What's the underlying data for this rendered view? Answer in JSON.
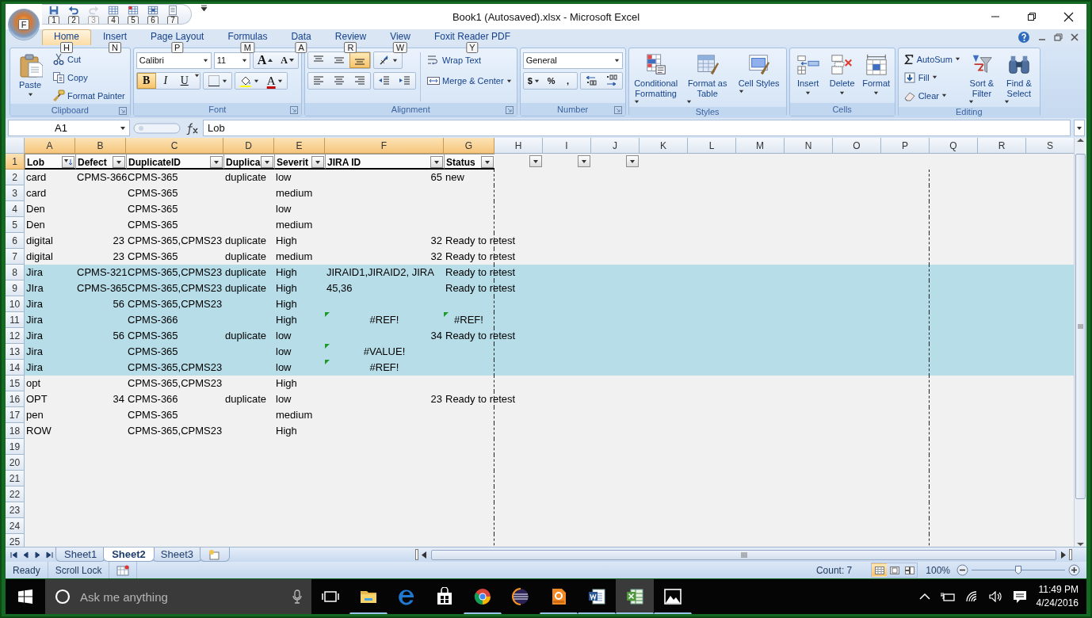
{
  "window": {
    "title": "Book1 (Autosaved).xlsx - Microsoft Excel",
    "office_keytip": "F"
  },
  "quick_access": [
    {
      "kind": "save",
      "keytip": "1",
      "disabled": false
    },
    {
      "kind": "undo",
      "keytip": "2",
      "disabled": false
    },
    {
      "kind": "redo",
      "keytip": "3",
      "disabled": true
    },
    {
      "kind": "form",
      "keytip": "4",
      "disabled": false
    },
    {
      "kind": "chart",
      "keytip": "5",
      "disabled": false
    },
    {
      "kind": "table",
      "keytip": "6",
      "disabled": false
    },
    {
      "kind": "print",
      "keytip": "7",
      "disabled": false
    }
  ],
  "tabs": [
    {
      "label": "Home",
      "keytip": "H",
      "selected": true
    },
    {
      "label": "Insert",
      "keytip": "N",
      "selected": false
    },
    {
      "label": "Page Layout",
      "keytip": "P",
      "selected": false
    },
    {
      "label": "Formulas",
      "keytip": "M",
      "selected": false
    },
    {
      "label": "Data",
      "keytip": "A",
      "selected": false
    },
    {
      "label": "Review",
      "keytip": "R",
      "selected": false
    },
    {
      "label": "View",
      "keytip": "W",
      "selected": false
    },
    {
      "label": "Foxit Reader PDF",
      "keytip": "Y",
      "selected": false
    }
  ],
  "ribbon": {
    "clipboard": {
      "label": "Clipboard",
      "paste": "Paste",
      "cut": "Cut",
      "copy": "Copy",
      "format_painter": "Format Painter"
    },
    "font": {
      "label": "Font",
      "font_name": "Calibri",
      "font_size": "11",
      "grow": "A",
      "shrink": "A",
      "bold": {
        "label": "B",
        "on": true
      },
      "italic": {
        "label": "I",
        "on": false
      },
      "underline": {
        "label": "U",
        "on": false
      },
      "font_color": "A"
    },
    "alignment": {
      "label": "Alignment",
      "vertical": [
        {
          "kind": "top",
          "on": false
        },
        {
          "kind": "middle",
          "on": false
        },
        {
          "kind": "bottom",
          "on": true
        }
      ],
      "horizontal": [
        {
          "kind": "left",
          "on": false
        },
        {
          "kind": "center",
          "on": false
        },
        {
          "kind": "right",
          "on": false
        }
      ],
      "wrap_text": "Wrap Text",
      "merge": "Merge & Center"
    },
    "number": {
      "label": "Number",
      "format": "General",
      "currency": "$",
      "percent": "%",
      "comma": ","
    },
    "styles": {
      "label": "Styles",
      "buttons": [
        {
          "kind": "conditional",
          "label": "Conditional Formatting"
        },
        {
          "kind": "table",
          "label": "Format as Table"
        },
        {
          "kind": "cellstyles",
          "label": "Cell Styles"
        }
      ]
    },
    "cells": {
      "label": "Cells",
      "buttons": [
        {
          "kind": "insert",
          "label": "Insert"
        },
        {
          "kind": "delete",
          "label": "Delete"
        },
        {
          "kind": "format",
          "label": "Format"
        }
      ]
    },
    "editing": {
      "label": "Editing",
      "autosum": "AutoSum",
      "fill": "Fill",
      "clear": "Clear",
      "sort": "Sort & Filter",
      "find": "Find & Select"
    }
  },
  "formula_bar": {
    "name_box": "A1",
    "value": "Lob"
  },
  "sheet": {
    "columns": [
      {
        "label": "A",
        "selected": true
      },
      {
        "label": "B",
        "selected": true
      },
      {
        "label": "C",
        "selected": true
      },
      {
        "label": "D",
        "selected": true
      },
      {
        "label": "E",
        "selected": true
      },
      {
        "label": "F",
        "selected": true
      },
      {
        "label": "G",
        "selected": true
      },
      {
        "label": "H",
        "selected": false
      },
      {
        "label": "I",
        "selected": false
      },
      {
        "label": "J",
        "selected": false
      },
      {
        "label": "K",
        "selected": false
      },
      {
        "label": "L",
        "selected": false
      },
      {
        "label": "M",
        "selected": false
      },
      {
        "label": "N",
        "selected": false
      },
      {
        "label": "O",
        "selected": false
      },
      {
        "label": "P",
        "selected": false
      },
      {
        "label": "Q",
        "selected": false
      },
      {
        "label": "R",
        "selected": false
      },
      {
        "label": "S",
        "selected": false
      }
    ],
    "rows": [
      {
        "number": "1",
        "selected": true,
        "shaded": false,
        "kind": "header",
        "cells": [
          {
            "text": "Lob",
            "filter": true,
            "sorted": true
          },
          {
            "text": "Defect",
            "filter": true,
            "sorted": false
          },
          {
            "text": "DuplicateID",
            "filter": true,
            "sorted": false
          },
          {
            "text": "Duplica",
            "filter": true,
            "sorted": false
          },
          {
            "text": "Severit",
            "filter": true,
            "sorted": false
          },
          {
            "text": "JIRA ID",
            "filter": true,
            "sorted": false
          },
          {
            "text": "Status",
            "filter": true,
            "sorted": false
          },
          {
            "filter": true,
            "sorted": false
          },
          {
            "filter": true,
            "sorted": false
          },
          {
            "filter": true,
            "sorted": false
          }
        ]
      },
      {
        "number": "2",
        "selected": false,
        "shaded": false,
        "kind": "data",
        "cells": [
          "card",
          "CPMS-366",
          "CPMS-365",
          "duplicate",
          "low",
          {
            "text": "65",
            "kind": "number"
          },
          "new"
        ]
      },
      {
        "number": "3",
        "selected": false,
        "shaded": false,
        "kind": "data",
        "cells": [
          "card",
          null,
          "CPMS-365",
          null,
          "medium"
        ]
      },
      {
        "number": "4",
        "selected": false,
        "shaded": false,
        "kind": "data",
        "cells": [
          "Den",
          null,
          "CPMS-365",
          null,
          "low"
        ]
      },
      {
        "number": "5",
        "selected": false,
        "shaded": false,
        "kind": "data",
        "cells": [
          "Den",
          null,
          "CPMS-365",
          null,
          "medium"
        ]
      },
      {
        "number": "6",
        "selected": false,
        "shaded": false,
        "kind": "data",
        "cells": [
          "digital",
          {
            "text": "23",
            "kind": "number"
          },
          "CPMS-365,CPMS23",
          "duplicate",
          "High",
          {
            "text": "32",
            "kind": "number"
          },
          "Ready to retest"
        ]
      },
      {
        "number": "7",
        "selected": false,
        "shaded": false,
        "kind": "data",
        "cells": [
          "digital",
          {
            "text": "23",
            "kind": "number"
          },
          "CPMS-365",
          "duplicate",
          "medium",
          {
            "text": "32",
            "kind": "number"
          },
          "Ready to retest"
        ]
      },
      {
        "number": "8",
        "selected": false,
        "shaded": true,
        "kind": "data",
        "cells": [
          "Jira",
          "CPMS-321",
          "CPMS-365,CPMS23",
          "duplicate",
          "High",
          "JIRAID1,JIRAID2, JIRA",
          "Ready to retest"
        ]
      },
      {
        "number": "9",
        "selected": false,
        "shaded": true,
        "kind": "data",
        "cells": [
          "JIra",
          "CPMS-365",
          "CPMS-365,CPMS23",
          "duplicate",
          "High",
          "45,36",
          "Ready to retest"
        ]
      },
      {
        "number": "10",
        "selected": false,
        "shaded": true,
        "kind": "data",
        "cells": [
          "Jira",
          {
            "text": "56",
            "kind": "number"
          },
          "CPMS-365,CPMS23",
          null,
          "High"
        ]
      },
      {
        "number": "11",
        "selected": false,
        "shaded": true,
        "kind": "data",
        "cells": [
          "Jira",
          null,
          "CPMS-366",
          null,
          "High",
          {
            "text": "#REF!",
            "kind": "error",
            "flagged": true
          },
          {
            "text": "#REF!",
            "kind": "error",
            "flagged": true
          }
        ]
      },
      {
        "number": "12",
        "selected": false,
        "shaded": true,
        "kind": "data",
        "cells": [
          "Jira",
          {
            "text": "56",
            "kind": "number"
          },
          "CPMS-365",
          "duplicate",
          "low",
          {
            "text": "34",
            "kind": "number"
          },
          "Ready to retest"
        ]
      },
      {
        "number": "13",
        "selected": false,
        "shaded": true,
        "kind": "data",
        "cells": [
          "Jira",
          null,
          "CPMS-365",
          null,
          "low",
          {
            "text": "#VALUE!",
            "kind": "error",
            "flagged": true
          }
        ]
      },
      {
        "number": "14",
        "selected": false,
        "shaded": true,
        "kind": "data",
        "cells": [
          "Jira",
          null,
          "CPMS-365,CPMS23",
          null,
          "low",
          {
            "text": "#REF!",
            "kind": "error",
            "flagged": true
          }
        ]
      },
      {
        "number": "15",
        "selected": false,
        "shaded": false,
        "kind": "data",
        "cells": [
          "opt",
          null,
          "CPMS-365,CPMS23",
          null,
          "High"
        ]
      },
      {
        "number": "16",
        "selected": false,
        "shaded": false,
        "kind": "data",
        "cells": [
          "OPT",
          {
            "text": "34",
            "kind": "number"
          },
          "CPMS-366",
          "duplicate",
          "low",
          {
            "text": "23",
            "kind": "number"
          },
          "Ready to retest"
        ]
      },
      {
        "number": "17",
        "selected": false,
        "shaded": false,
        "kind": "data",
        "cells": [
          "pen",
          null,
          "CPMS-365",
          null,
          "medium"
        ]
      },
      {
        "number": "18",
        "selected": false,
        "shaded": false,
        "kind": "data",
        "cells": [
          "ROW",
          null,
          "CPMS-365,CPMS23",
          null,
          "High"
        ]
      },
      {
        "number": "19",
        "selected": false,
        "shaded": false,
        "kind": "data"
      },
      {
        "number": "20",
        "selected": false,
        "shaded": false,
        "kind": "data"
      },
      {
        "number": "21",
        "selected": false,
        "shaded": false,
        "kind": "data"
      },
      {
        "number": "22",
        "selected": false,
        "shaded": false,
        "kind": "data"
      },
      {
        "number": "23",
        "selected": false,
        "shaded": false,
        "kind": "data"
      },
      {
        "number": "24",
        "selected": false,
        "shaded": false,
        "kind": "data"
      },
      {
        "number": "25",
        "selected": false,
        "shaded": false,
        "kind": "data"
      }
    ]
  },
  "sheet_tabs": [
    {
      "label": "Sheet1",
      "selected": false
    },
    {
      "label": "Sheet2",
      "selected": true
    },
    {
      "label": "Sheet3",
      "selected": false
    }
  ],
  "status_bar": {
    "mode": "Ready",
    "scroll_lock": "Scroll Lock",
    "count": "Count: 7",
    "views": [
      {
        "kind": "normal",
        "selected": true
      },
      {
        "kind": "page_layout",
        "selected": false
      },
      {
        "kind": "page_break",
        "selected": false
      }
    ],
    "zoom": "100%",
    "zoom_slider": {
      "level": 0.5
    }
  },
  "taskbar": {
    "search": {
      "placeholder": "Ask me anything"
    },
    "apps": [
      {
        "kind": "folder",
        "running": true,
        "active": false
      },
      {
        "kind": "edge",
        "running": false,
        "active": false
      },
      {
        "kind": "store",
        "running": false,
        "active": false
      },
      {
        "kind": "chrome",
        "running": true,
        "active": false
      },
      {
        "kind": "sphere",
        "running": false,
        "active": false
      },
      {
        "kind": "pdf",
        "running": true,
        "active": false
      },
      {
        "kind": "word",
        "running": true,
        "active": false
      },
      {
        "kind": "excel",
        "running": true,
        "active": true
      },
      {
        "kind": "photos",
        "running": true,
        "active": false
      }
    ],
    "time": "11:49 PM",
    "date": "4/24/2016"
  }
}
